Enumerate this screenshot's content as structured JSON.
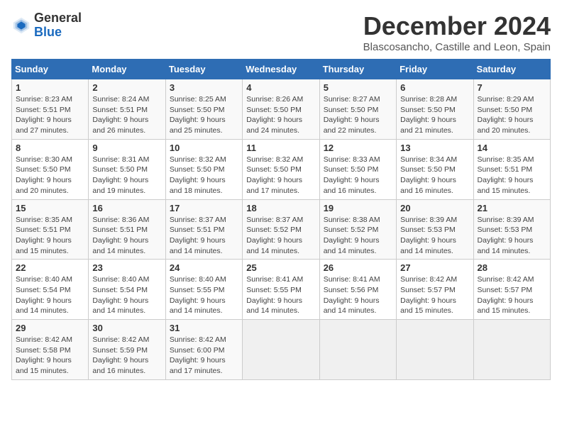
{
  "header": {
    "logo_general": "General",
    "logo_blue": "Blue",
    "month_title": "December 2024",
    "location": "Blascosancho, Castille and Leon, Spain"
  },
  "days_of_week": [
    "Sunday",
    "Monday",
    "Tuesday",
    "Wednesday",
    "Thursday",
    "Friday",
    "Saturday"
  ],
  "weeks": [
    [
      {
        "day": "1",
        "sunrise": "8:23 AM",
        "sunset": "5:51 PM",
        "daylight": "9 hours and 27 minutes."
      },
      {
        "day": "2",
        "sunrise": "8:24 AM",
        "sunset": "5:51 PM",
        "daylight": "9 hours and 26 minutes."
      },
      {
        "day": "3",
        "sunrise": "8:25 AM",
        "sunset": "5:50 PM",
        "daylight": "9 hours and 25 minutes."
      },
      {
        "day": "4",
        "sunrise": "8:26 AM",
        "sunset": "5:50 PM",
        "daylight": "9 hours and 24 minutes."
      },
      {
        "day": "5",
        "sunrise": "8:27 AM",
        "sunset": "5:50 PM",
        "daylight": "9 hours and 22 minutes."
      },
      {
        "day": "6",
        "sunrise": "8:28 AM",
        "sunset": "5:50 PM",
        "daylight": "9 hours and 21 minutes."
      },
      {
        "day": "7",
        "sunrise": "8:29 AM",
        "sunset": "5:50 PM",
        "daylight": "9 hours and 20 minutes."
      }
    ],
    [
      {
        "day": "8",
        "sunrise": "8:30 AM",
        "sunset": "5:50 PM",
        "daylight": "9 hours and 20 minutes."
      },
      {
        "day": "9",
        "sunrise": "8:31 AM",
        "sunset": "5:50 PM",
        "daylight": "9 hours and 19 minutes."
      },
      {
        "day": "10",
        "sunrise": "8:32 AM",
        "sunset": "5:50 PM",
        "daylight": "9 hours and 18 minutes."
      },
      {
        "day": "11",
        "sunrise": "8:32 AM",
        "sunset": "5:50 PM",
        "daylight": "9 hours and 17 minutes."
      },
      {
        "day": "12",
        "sunrise": "8:33 AM",
        "sunset": "5:50 PM",
        "daylight": "9 hours and 16 minutes."
      },
      {
        "day": "13",
        "sunrise": "8:34 AM",
        "sunset": "5:50 PM",
        "daylight": "9 hours and 16 minutes."
      },
      {
        "day": "14",
        "sunrise": "8:35 AM",
        "sunset": "5:51 PM",
        "daylight": "9 hours and 15 minutes."
      }
    ],
    [
      {
        "day": "15",
        "sunrise": "8:35 AM",
        "sunset": "5:51 PM",
        "daylight": "9 hours and 15 minutes."
      },
      {
        "day": "16",
        "sunrise": "8:36 AM",
        "sunset": "5:51 PM",
        "daylight": "9 hours and 14 minutes."
      },
      {
        "day": "17",
        "sunrise": "8:37 AM",
        "sunset": "5:51 PM",
        "daylight": "9 hours and 14 minutes."
      },
      {
        "day": "18",
        "sunrise": "8:37 AM",
        "sunset": "5:52 PM",
        "daylight": "9 hours and 14 minutes."
      },
      {
        "day": "19",
        "sunrise": "8:38 AM",
        "sunset": "5:52 PM",
        "daylight": "9 hours and 14 minutes."
      },
      {
        "day": "20",
        "sunrise": "8:39 AM",
        "sunset": "5:53 PM",
        "daylight": "9 hours and 14 minutes."
      },
      {
        "day": "21",
        "sunrise": "8:39 AM",
        "sunset": "5:53 PM",
        "daylight": "9 hours and 14 minutes."
      }
    ],
    [
      {
        "day": "22",
        "sunrise": "8:40 AM",
        "sunset": "5:54 PM",
        "daylight": "9 hours and 14 minutes."
      },
      {
        "day": "23",
        "sunrise": "8:40 AM",
        "sunset": "5:54 PM",
        "daylight": "9 hours and 14 minutes."
      },
      {
        "day": "24",
        "sunrise": "8:40 AM",
        "sunset": "5:55 PM",
        "daylight": "9 hours and 14 minutes."
      },
      {
        "day": "25",
        "sunrise": "8:41 AM",
        "sunset": "5:55 PM",
        "daylight": "9 hours and 14 minutes."
      },
      {
        "day": "26",
        "sunrise": "8:41 AM",
        "sunset": "5:56 PM",
        "daylight": "9 hours and 14 minutes."
      },
      {
        "day": "27",
        "sunrise": "8:42 AM",
        "sunset": "5:57 PM",
        "daylight": "9 hours and 15 minutes."
      },
      {
        "day": "28",
        "sunrise": "8:42 AM",
        "sunset": "5:57 PM",
        "daylight": "9 hours and 15 minutes."
      }
    ],
    [
      {
        "day": "29",
        "sunrise": "8:42 AM",
        "sunset": "5:58 PM",
        "daylight": "9 hours and 15 minutes."
      },
      {
        "day": "30",
        "sunrise": "8:42 AM",
        "sunset": "5:59 PM",
        "daylight": "9 hours and 16 minutes."
      },
      {
        "day": "31",
        "sunrise": "8:42 AM",
        "sunset": "6:00 PM",
        "daylight": "9 hours and 17 minutes."
      },
      null,
      null,
      null,
      null
    ]
  ]
}
